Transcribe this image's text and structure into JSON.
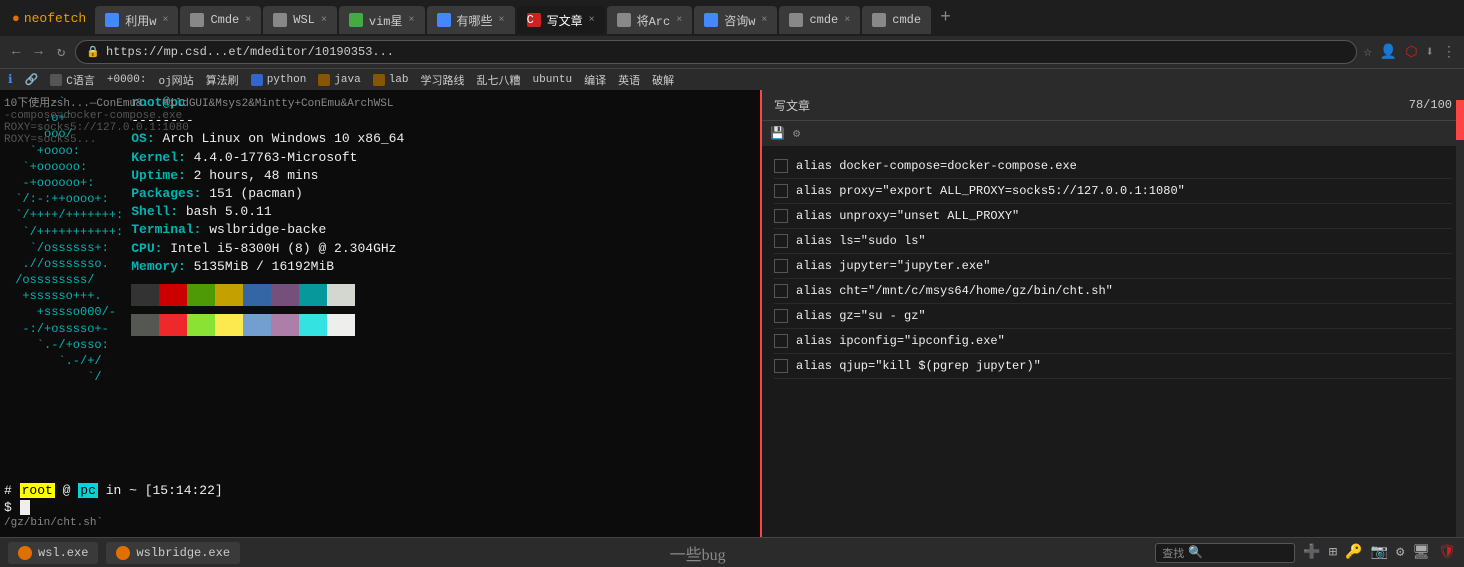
{
  "browser": {
    "tabs": [
      {
        "id": "neofetch",
        "label": "neofetch",
        "favicon_color": "#e07000",
        "active": false
      },
      {
        "id": "利用w",
        "label": "利用w",
        "favicon_color": "#4488ff",
        "active": false,
        "closeable": true
      },
      {
        "id": "cmde",
        "label": "Cmde",
        "favicon_color": "#888",
        "active": false,
        "closeable": true
      },
      {
        "id": "wsl",
        "label": "WSL",
        "favicon_color": "#888",
        "active": false,
        "closeable": true
      },
      {
        "id": "vim星",
        "label": "vim星",
        "favicon_color": "#44aa44",
        "active": false,
        "closeable": true
      },
      {
        "id": "有哪些",
        "label": "有哪些",
        "favicon_color": "#4488ff",
        "active": false,
        "closeable": true
      },
      {
        "id": "写文章",
        "label": "写文章",
        "favicon_color": "#cc2222",
        "active": true,
        "closeable": true
      },
      {
        "id": "将Arc",
        "label": "将Arc",
        "favicon_color": "#888",
        "active": false,
        "closeable": true
      },
      {
        "id": "咨询w",
        "label": "咨询w",
        "favicon_color": "#4488ff",
        "active": false,
        "closeable": true
      },
      {
        "id": "cmde2",
        "label": "cmde",
        "favicon_color": "#888",
        "active": false,
        "closeable": true
      },
      {
        "id": "cmde3",
        "label": "cmde",
        "favicon_color": "#888",
        "active": false,
        "closeable": true
      }
    ],
    "address": "https://mp.csd...et/mdeditor/10190353...",
    "score": "78/100"
  },
  "bookmarks": [
    {
      "label": "C语言"
    },
    {
      "label": "+0000:"
    },
    {
      "label": "oj网站"
    },
    {
      "label": "算法刷"
    },
    {
      "label": "python"
    },
    {
      "label": "java"
    },
    {
      "label": "lab"
    },
    {
      "label": "学习路线"
    },
    {
      "label": "乱七八糟"
    },
    {
      "label": "ubuntu"
    },
    {
      "label": "编译"
    },
    {
      "label": "英语"
    },
    {
      "label": "破解"
    }
  ],
  "terminal": {
    "os_art": "      -`\n     .o+`\n    `ooo/\n   `+oooo:\n  `+oooooo:\n  -+oooooo+:\n `/:-:++oooo+:\n `/++++/+++++++:\n  `/+++++++++++:\n   `/ossssss+:\n  .//osssssso.\n /ossssssss/\n  +ssssso+++.\n    +sssso000/-\n  -:/+osssso+-\n    `.-/+osso:\n       `.-/+/\n           `/",
    "info": {
      "user_host": "root@pc",
      "separator": "--------",
      "os": "OS: Arch Linux on Windows 10 x86_64",
      "kernel": "Kernel: 4.4.0-17763-Microsoft",
      "uptime": "Uptime: 2 hours, 48 mins",
      "packages": "Packages: 151 (pacman)",
      "shell": "Shell: bash 5.0.11",
      "terminal": "Terminal: wslbridge-backe",
      "cpu": "CPU: Intel i5-8300H (8) @ 2.304GHz",
      "memory": "Memory: 5135MiB / 16192MiB"
    },
    "swatches": [
      "#333333",
      "#cc0000",
      "#4e9a06",
      "#c4a000",
      "#3465a4",
      "#75507b",
      "#06989a",
      "#d3d7cf",
      "#555753",
      "#ef2929",
      "#8ae234",
      "#fce94f",
      "#729fcf",
      "#ad7fa8",
      "#34e2e2",
      "#eeeeec"
    ],
    "prompt": {
      "hash": "#",
      "user": "root",
      "at": "@",
      "host": "pc",
      "in": "in",
      "dir": "~",
      "time": "[15:14:22]"
    },
    "left_content_lines": [
      "10下使用zsh...—ConEmu&...MildGUI&Msys2&Mintty+ConEmu&ArchWSL",
      "-compose=docker-compose.exe",
      "ROXY=socks5://127.0.0.1:1080",
      "ROXY=socks5...",
      "",
      ".ooo/",
      "`+oooo:",
      "`+oooooo:",
      "`-+oooooo+:",
      "/:-:++oooo+:",
      "/++++/+++++++:",
      "`/+++++++++++:",
      "  `/ossssss+:",
      " .//osssssso.",
      "/ossssssss/",
      " +ssssso+++.",
      "   +sssso000/-",
      " -:/+osssso+-",
      "   `.-/+osso:",
      "      `.-/+/",
      "          `/",
      "",
      "/gz/bin/cht.sh`"
    ]
  },
  "editor": {
    "header_text": "写文章",
    "score_label": "78/100",
    "toolbar_buttons": [
      "保存",
      "工具"
    ],
    "lines": [
      {
        "checked": false,
        "text": "alias docker-compose=docker-compose.exe"
      },
      {
        "checked": false,
        "text": "alias proxy=\"export ALL_PROXY=socks5://127.0.0.1:1080\""
      },
      {
        "checked": false,
        "text": "alias unproxy=\"unset ALL_PROXY\""
      },
      {
        "checked": false,
        "text": "alias ls=\"sudo ls\""
      },
      {
        "checked": false,
        "text": "alias jupyter=\"jupyter.exe\""
      },
      {
        "checked": false,
        "text": "alias cht=\"/mnt/c/msys64/home/gz/bin/cht.sh\""
      },
      {
        "checked": false,
        "text": "alias gz=\"su - gz\""
      },
      {
        "checked": false,
        "text": "alias ipconfig=\"ipconfig.exe\""
      },
      {
        "checked": false,
        "text": "alias qjup=\"kill $(pgrep jupyter)\""
      }
    ]
  },
  "taskbar": {
    "items": [
      {
        "label": "wsl.exe"
      },
      {
        "label": "wslbridge.exe"
      }
    ],
    "search_placeholder": "查找",
    "logo_text": "一些bug"
  },
  "colors": {
    "accent": "#ff4444",
    "terminal_bg": "#0c0c0c",
    "terminal_cyan": "#00b4b4",
    "terminal_green": "#00ff00",
    "browser_bg": "#2b2b2b",
    "tab_active_bg": "#1a1a1a"
  }
}
